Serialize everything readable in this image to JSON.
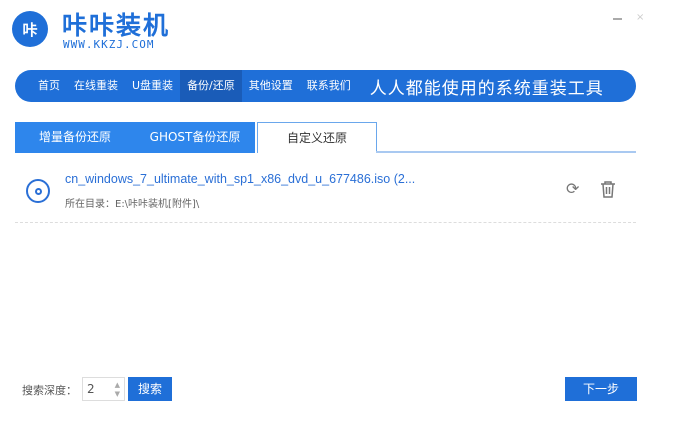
{
  "brand": {
    "logo_text": "咔",
    "name": "咔咔装机",
    "url": "WWW.KKZJ.COM"
  },
  "window": {
    "minimize": "—",
    "close": "×"
  },
  "nav": {
    "items": [
      "首页",
      "在线重装",
      "U盘重装",
      "备份/还原",
      "其他设置",
      "联系我们"
    ],
    "active": 3,
    "slogan": "人人都能使用的系统重装工具"
  },
  "tabs": [
    {
      "label": "增量备份还原"
    },
    {
      "label": "GHOST备份还原"
    },
    {
      "label": "自定义还原",
      "active": true
    }
  ],
  "files": [
    {
      "name": "cn_windows_7_ultimate_with_sp1_x86_dvd_u_677486.iso (2...",
      "path": "所在目录：E:\\咔咔装机[附件]\\"
    }
  ],
  "footer": {
    "depth_label": "搜索深度：",
    "depth_value": "2",
    "search_label": "搜索",
    "next_label": "下一步"
  },
  "colors": {
    "accent": "#1f6fd8",
    "tab": "#2e86ec"
  }
}
